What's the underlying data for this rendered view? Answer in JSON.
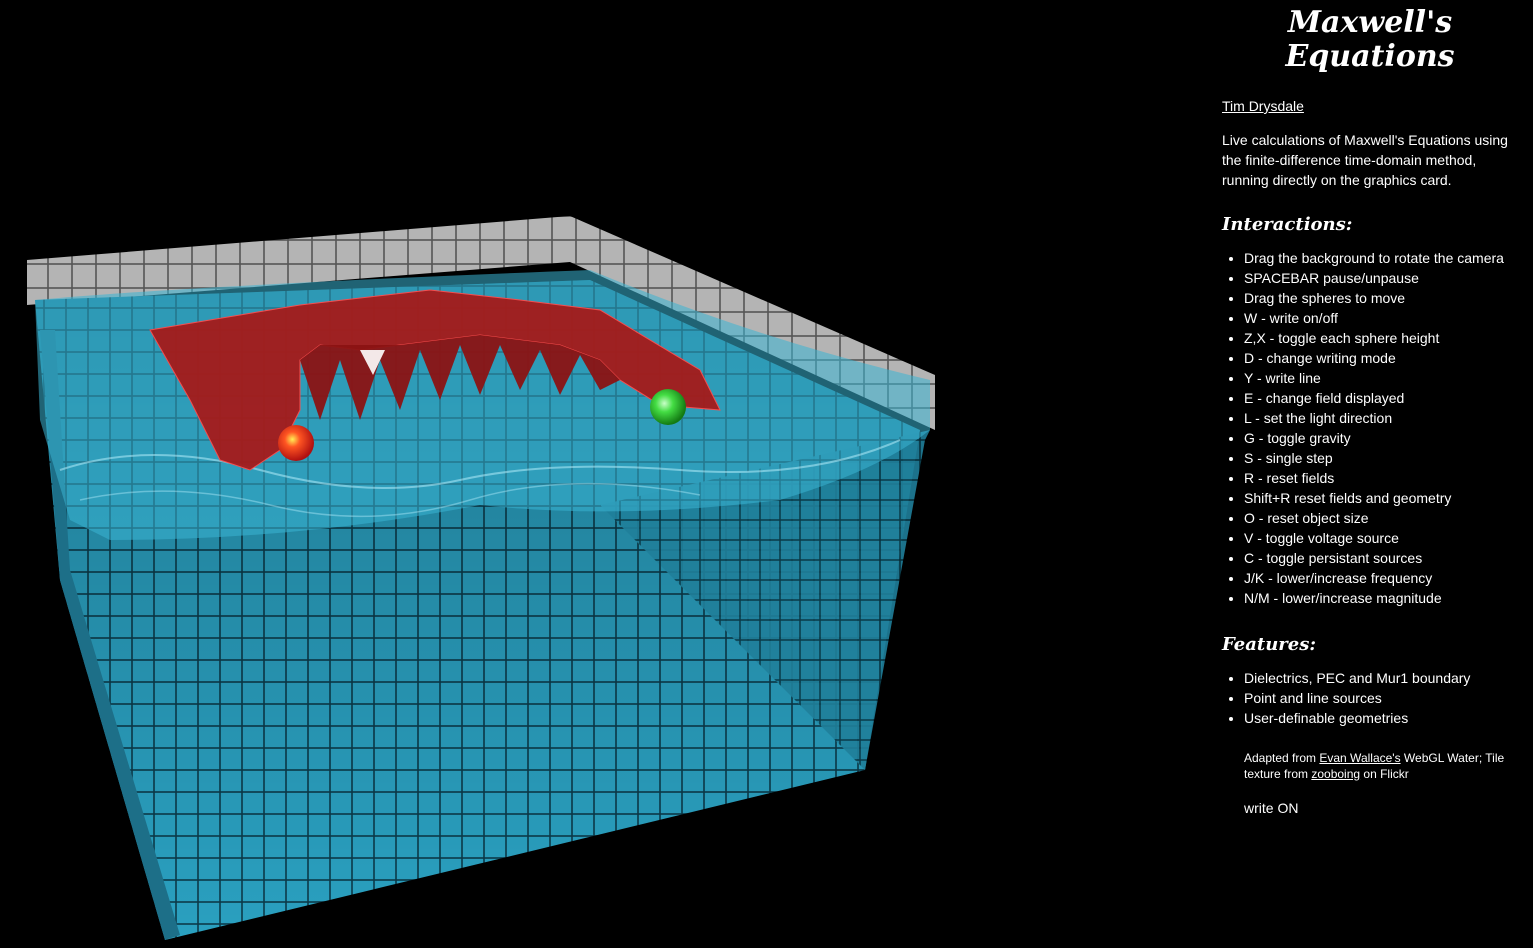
{
  "title": {
    "line1": "Maxwell's",
    "line2": "Equations"
  },
  "author": "Tim Drysdale",
  "description": "Live calculations of Maxwell's Equations using the finite-difference time-domain method, running directly on the graphics card.",
  "interactions": {
    "heading": "Interactions:",
    "items": [
      "Drag the background to rotate the camera",
      "SPACEBAR pause/unpause",
      "Drag the spheres to move",
      "W - write on/off",
      "Z,X - toggle each sphere height",
      "D - change writing mode",
      "Y - write line",
      "E - change field displayed",
      "L - set the light direction",
      "G - toggle gravity",
      "S - single step",
      "R - reset fields",
      "Shift+R reset fields and geometry",
      "O - reset object size",
      "V - toggle voltage source",
      "C - toggle persistant sources",
      "J/K - lower/increase frequency",
      "N/M - lower/increase magnitude"
    ]
  },
  "features": {
    "heading": "Features:",
    "items": [
      "Dielectrics, PEC and Mur1 boundary",
      "Point and line sources",
      "User-definable geometries"
    ]
  },
  "credits": {
    "prefix": "Adapted from ",
    "link1": "Evan Wallace's",
    "middle": " WebGL Water; Tile texture from ",
    "link2": "zooboing",
    "suffix": " on Flickr"
  },
  "status": "write ON",
  "colors": {
    "background": "#000000",
    "water": "#2a9ab8",
    "field": "#b22222",
    "sphere_red": "#ff3b1f",
    "sphere_green": "#3fd23f",
    "wall_tile": "#a8a8a8"
  }
}
